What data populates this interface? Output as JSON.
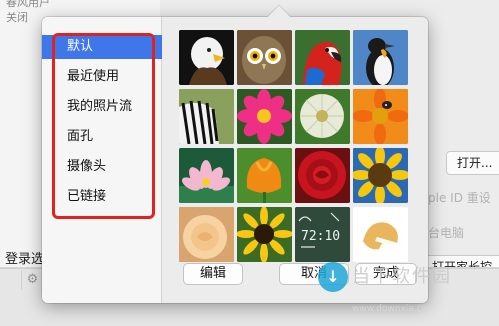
{
  "background": {
    "top_text_1": "春风用户",
    "top_text_2": "关闭",
    "login_label": "登录选",
    "add_icon": "plus-icon",
    "gear_icon": "gear-icon",
    "open_button": "打开...",
    "apple_id_text": "ple ID 重设",
    "computer_text": "台电脑",
    "open_parental_button": "打开家长控"
  },
  "popover": {
    "sources": [
      {
        "label": "默认",
        "selected": true
      },
      {
        "label": "最近使用",
        "selected": false
      },
      {
        "label": "我的照片流",
        "selected": false
      },
      {
        "label": "面孔",
        "selected": false
      },
      {
        "label": "摄像头",
        "selected": false
      },
      {
        "label": "已链接",
        "selected": false
      }
    ],
    "pictures": [
      "eagle",
      "owl",
      "parrot",
      "penguin",
      "zebra",
      "pink-flower",
      "dandelion",
      "ladybug-flower",
      "lotus",
      "orange-tulip",
      "red-rose",
      "sunflower",
      "yellow-rose",
      "gerbera-daisy",
      "chalkboard",
      "fortune-cookie"
    ],
    "chalk_text": "72:10",
    "edit_button": "编辑",
    "cancel_button": "取消",
    "done_button": "完成"
  },
  "watermark": {
    "logo": "↓",
    "text": "当下软件园",
    "url": "www.downxia.com"
  },
  "colors": {
    "selection": "#3f77ea",
    "annotation": "#e0231f"
  }
}
